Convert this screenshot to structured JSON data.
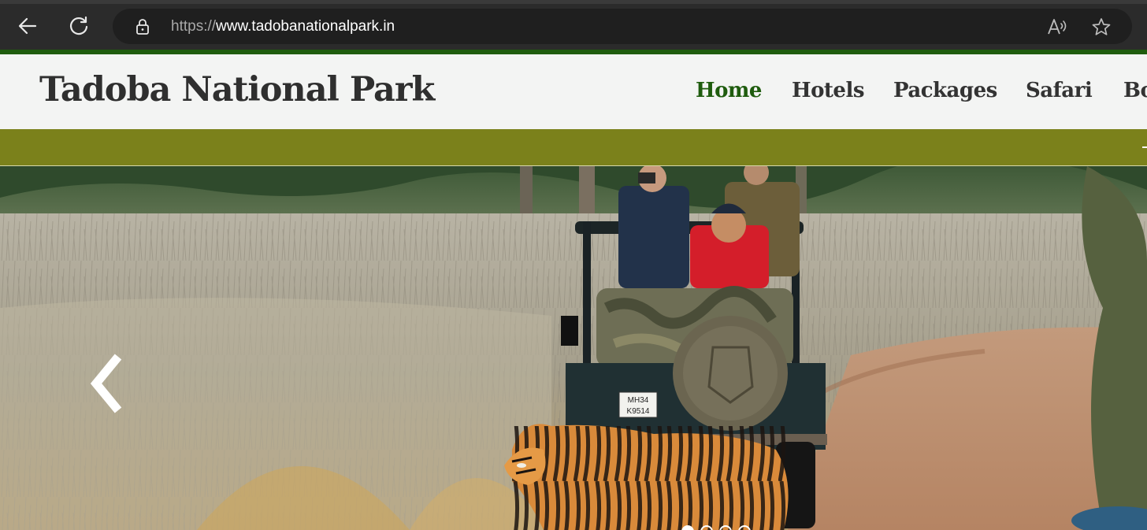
{
  "browser": {
    "url_scheme": "https://",
    "url_host": "www.tadobanationalpark.in",
    "icons": [
      "back-icon",
      "reload-icon",
      "lock-icon",
      "read-aloud-icon",
      "favorite-star-icon"
    ]
  },
  "site": {
    "brand": "Tadoba National Park",
    "nav": [
      {
        "label": "Home",
        "active": true
      },
      {
        "label": "Hotels",
        "active": false
      },
      {
        "label": "Packages",
        "active": false
      },
      {
        "label": "Safari",
        "active": false
      },
      {
        "label": "Bo",
        "active": false
      }
    ]
  },
  "hero": {
    "prev_arrow": "❮",
    "plate_line1": "MH34",
    "plate_line2": "K9514",
    "slides_total": 4,
    "active_slide": 1
  },
  "colors": {
    "accent_green": "#1f5c0e",
    "olive_bar": "#7b811b",
    "header_bg": "#f3f4f3"
  }
}
